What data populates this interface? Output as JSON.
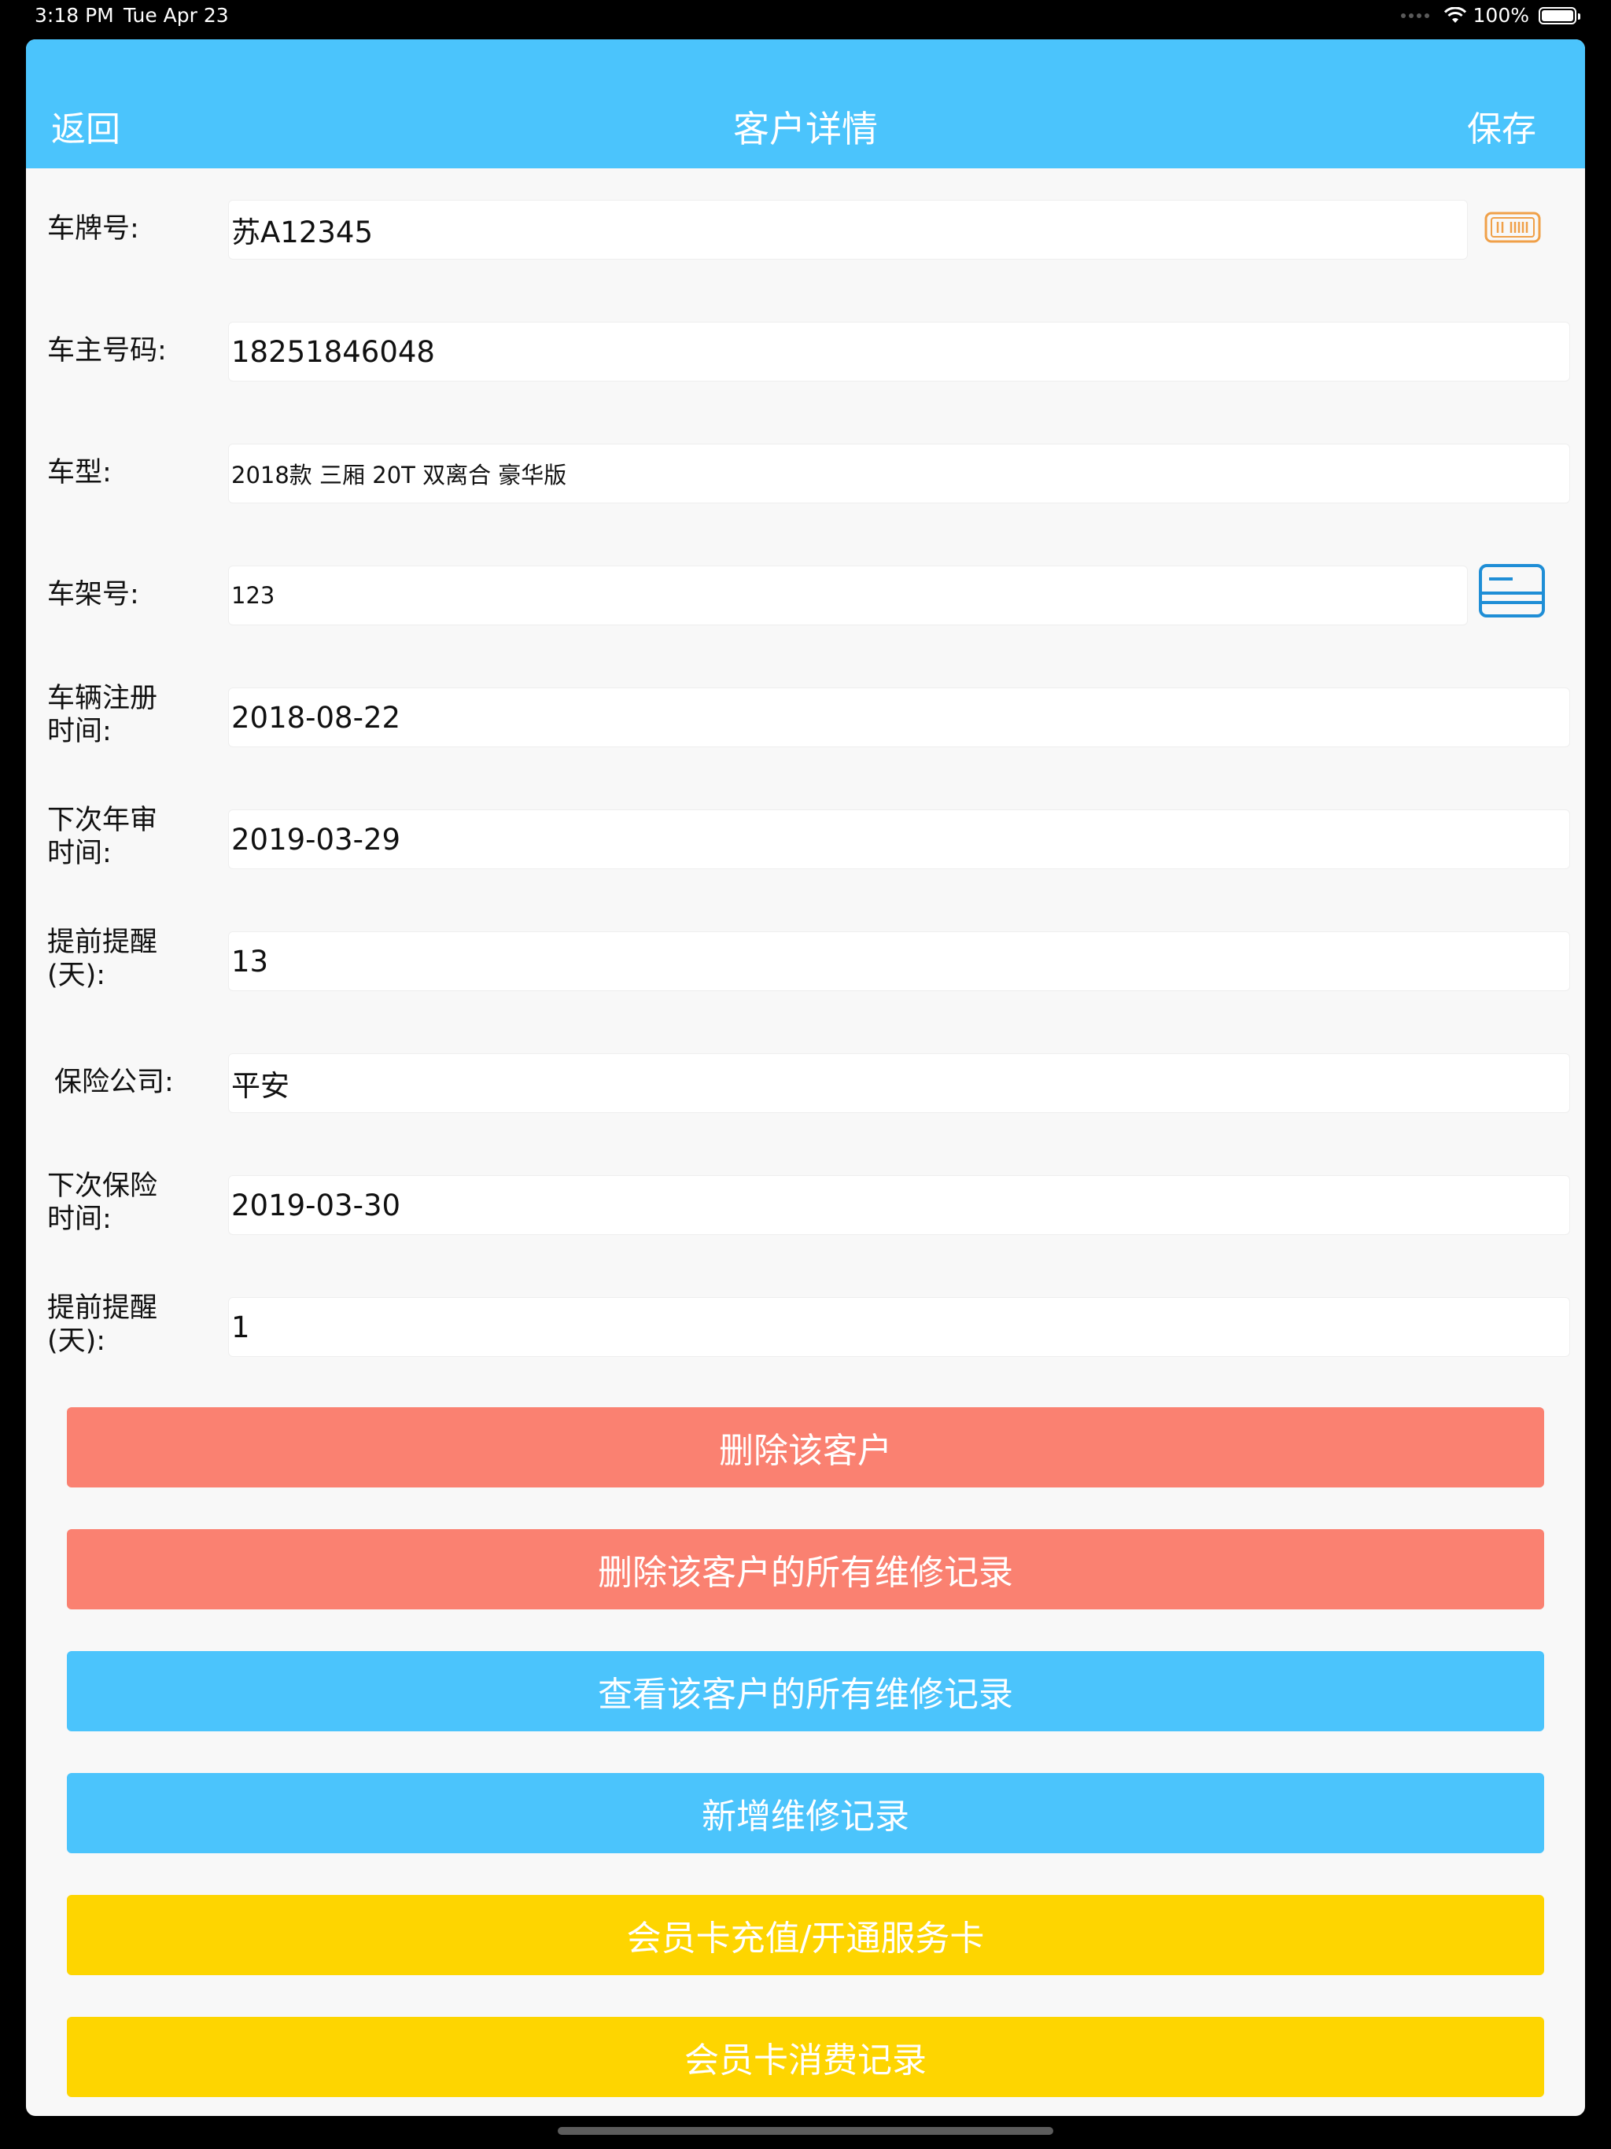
{
  "status_bar": {
    "time": "3:18 PM",
    "date": "Tue Apr 23",
    "battery": "100%"
  },
  "nav": {
    "back": "返回",
    "title": "客户详情",
    "save": "保存"
  },
  "fields": {
    "plate": {
      "label": "车牌号:",
      "value": "苏A12345"
    },
    "phone": {
      "label": "车主号码:",
      "value": "18251846048"
    },
    "model": {
      "label": "车型:",
      "value": "2018款 三厢 20T 双离合 豪华版"
    },
    "vin": {
      "label": "车架号:",
      "value": "123"
    },
    "register_date": {
      "label_line1": "车辆注册",
      "label_line2": "时间:",
      "value": "2018-08-22"
    },
    "inspection_date": {
      "label_line1": "下次年审",
      "label_line2": "时间:",
      "value": "2019-03-29"
    },
    "inspection_remind": {
      "label_line1": "提前提醒",
      "label_line2": "(天):",
      "value": "13"
    },
    "insurer": {
      "label": "保险公司:",
      "value": "平安"
    },
    "insurance_date": {
      "label_line1": "下次保险",
      "label_line2": "时间:",
      "value": "2019-03-30"
    },
    "insurance_remind": {
      "label_line1": "提前提醒",
      "label_line2": "(天):",
      "value": "1"
    }
  },
  "buttons": {
    "delete_customer": "删除该客户",
    "delete_records": "删除该客户的所有维修记录",
    "view_records": "查看该客户的所有维修记录",
    "add_record": "新增维修记录",
    "member_recharge": "会员卡充值/开通服务卡",
    "member_history": "会员卡消费记录"
  },
  "colors": {
    "nav": "#4bc4fc",
    "danger": "#fa8171",
    "primary": "#4bc4fc",
    "member": "#fed500",
    "plate_scan_icon": "#f0a048",
    "card_scan_icon": "#1f8ed6"
  },
  "icons": {
    "plate_scan": "license-plate-scan-icon",
    "vin_scan": "card-scan-icon"
  }
}
